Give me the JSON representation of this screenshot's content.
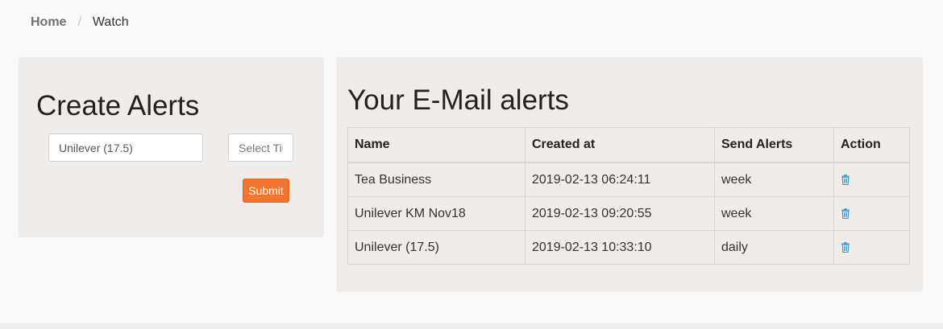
{
  "breadcrumb": {
    "home": "Home",
    "separator": "/",
    "current": "Watch"
  },
  "create": {
    "title": "Create Alerts",
    "query_value": "Unilever (17.5)",
    "time_placeholder": "Select Time",
    "submit_label": "Submit",
    "submit_color": "#f3762e"
  },
  "alerts": {
    "title": "Your E-Mail alerts",
    "headers": {
      "name": "Name",
      "created": "Created at",
      "send": "Send Alerts",
      "action": "Action"
    },
    "rows": [
      {
        "name": "Tea Business",
        "created": "2019-02-13 06:24:11",
        "send": "week",
        "action_icon": "trash-icon"
      },
      {
        "name": "Unilever KM Nov18",
        "created": "2019-02-13 09:20:55",
        "send": "week",
        "action_icon": "trash-icon"
      },
      {
        "name": "Unilever (17.5)",
        "created": "2019-02-13 10:33:10",
        "send": "daily",
        "action_icon": "trash-icon"
      }
    ],
    "icon_color": "#3a9ad9"
  }
}
